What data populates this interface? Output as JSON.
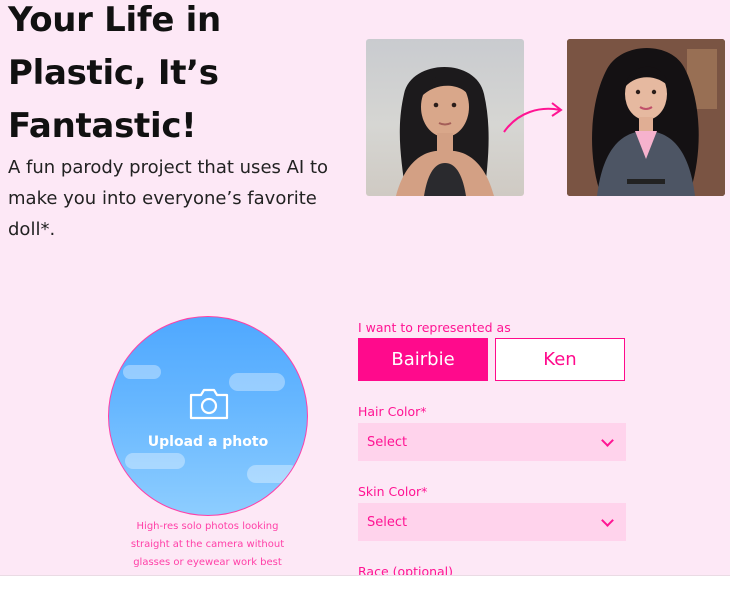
{
  "hero": {
    "title": "Your Life in Plastic, It’s Fantastic!",
    "subtitle": "A fun parody project that uses AI to make you into everyone’s favorite doll*."
  },
  "upload": {
    "label": "Upload a photo",
    "hint": "High-res solo photos looking straight at the camera without glasses or eyewear work best",
    "icon": "camera-icon"
  },
  "form": {
    "represent_label": "I want to represented as",
    "options": [
      "Bairbie",
      "Ken"
    ],
    "selected_option": "Bairbie",
    "hair_color": {
      "label": "Hair Color*",
      "value": "Select"
    },
    "skin_color": {
      "label": "Skin Color*",
      "value": "Select"
    },
    "race": {
      "label": "Race (optional)"
    }
  },
  "colors": {
    "background": "#fde8f6",
    "accent": "#ff0a8c",
    "upload_blue": "#5db0ff",
    "select_bg": "#ffd3ec"
  }
}
